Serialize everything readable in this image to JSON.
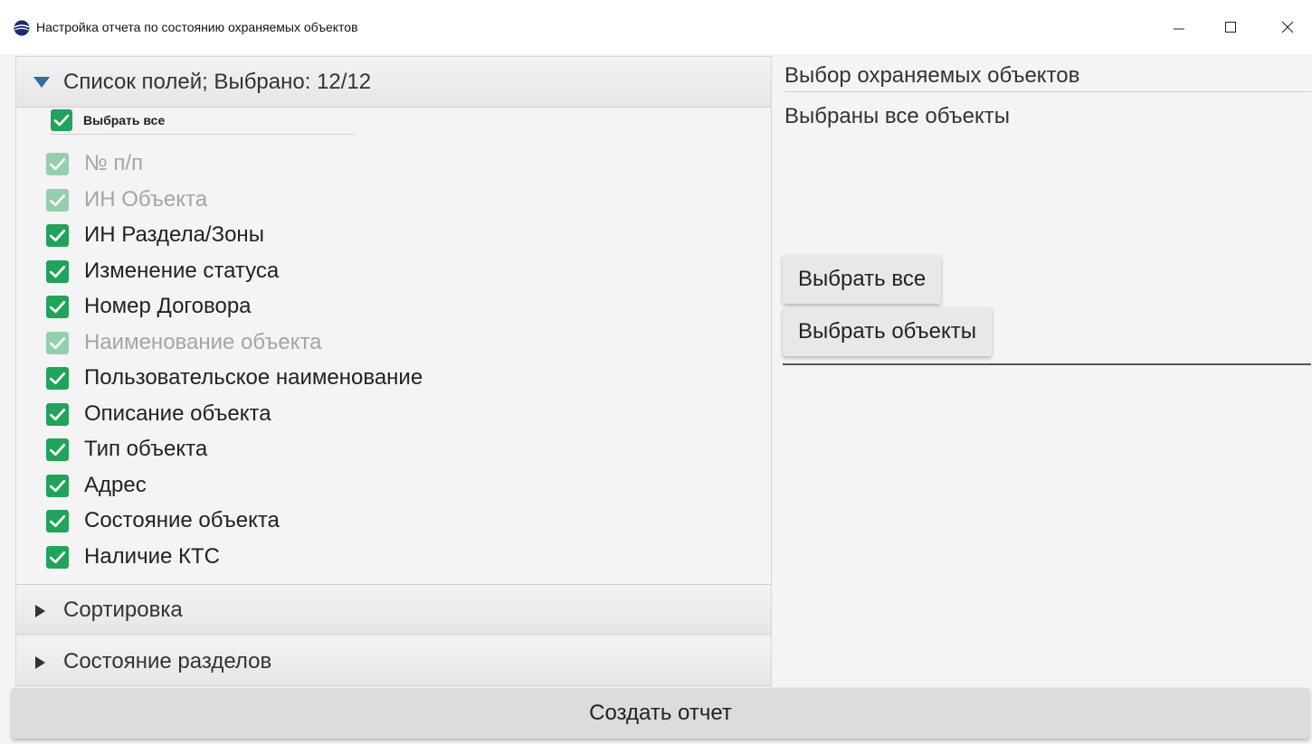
{
  "window": {
    "title": "Настройка отчета по состоянию охраняемых объектов",
    "icon": "globe-app-icon",
    "controls": {
      "minimize": "minimize-icon",
      "maximize": "maximize-icon",
      "close": "close-icon"
    }
  },
  "fields_pane": {
    "header": "Список полей; Выбрано: 12/12",
    "expanded": true,
    "select_all": {
      "label": "Выбрать все",
      "checked": true
    },
    "items": [
      {
        "label": "№ п/п",
        "checked": true,
        "disabled": true
      },
      {
        "label": "ИН Объекта",
        "checked": true,
        "disabled": true
      },
      {
        "label": "ИН Раздела/Зоны",
        "checked": true,
        "disabled": false
      },
      {
        "label": "Изменение статуса",
        "checked": true,
        "disabled": false
      },
      {
        "label": "Номер Договора",
        "checked": true,
        "disabled": false
      },
      {
        "label": "Наименование объекта",
        "checked": true,
        "disabled": true
      },
      {
        "label": "Пользовательское наименование",
        "checked": true,
        "disabled": false
      },
      {
        "label": "Описание объекта",
        "checked": true,
        "disabled": false
      },
      {
        "label": "Тип объекта",
        "checked": true,
        "disabled": false
      },
      {
        "label": "Адрес",
        "checked": true,
        "disabled": false
      },
      {
        "label": "Состояние объекта",
        "checked": true,
        "disabled": false
      },
      {
        "label": "Наличие КТС",
        "checked": true,
        "disabled": false
      }
    ]
  },
  "sort_pane": {
    "header": "Сортировка",
    "expanded": false
  },
  "sections_pane": {
    "header": "Состояние разделов",
    "expanded": false
  },
  "objects_panel": {
    "title": "Выбор охраняемых объектов",
    "status": "Выбраны все объекты",
    "select_all_button": "Выбрать все",
    "select_objects_button": "Выбрать объекты"
  },
  "create_report_button": "Создать отчет",
  "colors": {
    "checkbox_accent": "#1fa45a",
    "expand_arrow": "#2a6f9e",
    "background": "#f4f4f4"
  }
}
